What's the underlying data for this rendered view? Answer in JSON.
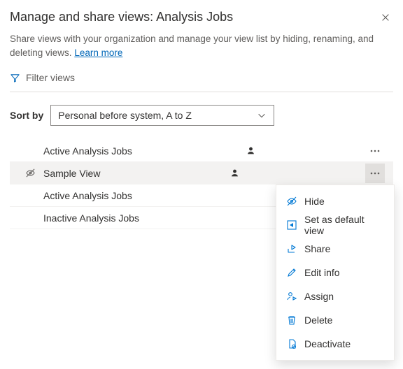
{
  "header": {
    "title": "Manage and share views: Analysis Jobs",
    "description_a": "Share views with your organization and manage your view list by hiding, renaming, and deleting views. ",
    "learn_more": "Learn more"
  },
  "filter": {
    "label": "Filter views"
  },
  "sort": {
    "label": "Sort by",
    "selected": "Personal before system, A to Z"
  },
  "views": [
    {
      "label": "Active Analysis Jobs",
      "personal": true,
      "hidden": false,
      "selected": false,
      "show_more": true
    },
    {
      "label": "Sample View",
      "personal": true,
      "hidden": true,
      "selected": true,
      "show_more": true
    },
    {
      "label": "Active Analysis Jobs",
      "personal": false,
      "hidden": false,
      "selected": false,
      "show_more": false
    },
    {
      "label": "Inactive Analysis Jobs",
      "personal": false,
      "hidden": false,
      "selected": false,
      "show_more": false
    }
  ],
  "menu": {
    "hide": "Hide",
    "set_default": "Set as default view",
    "share": "Share",
    "edit": "Edit info",
    "assign": "Assign",
    "delete": "Delete",
    "deactivate": "Deactivate"
  }
}
